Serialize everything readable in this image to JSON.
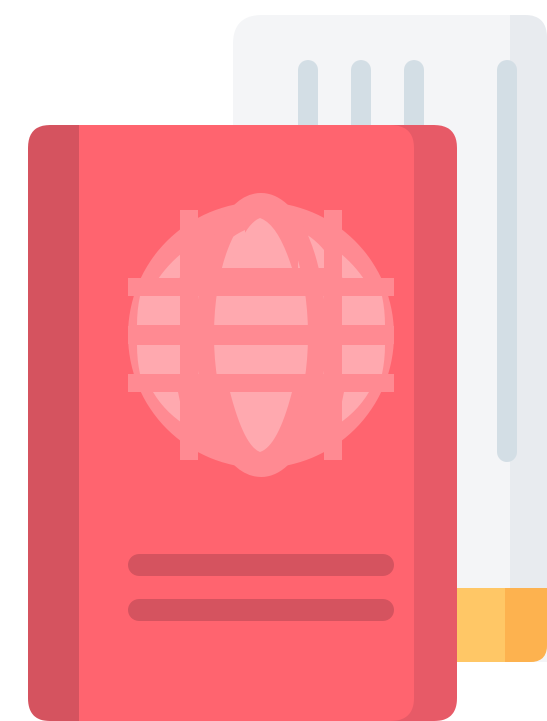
{
  "illustration": {
    "subject": "passport-with-boarding-ticket-icon",
    "colors": {
      "ticket_body": "#F4F5F7",
      "ticket_shade": "#E8EBEF",
      "ticket_bars": "#D3DEE5",
      "ticket_stub": "#FFC766",
      "ticket_stub_shade": "#FDB24F",
      "passport_cover": "#FF646F",
      "passport_spine": "#D5535F",
      "passport_right_edge": "#E75A67",
      "globe": "#FF8A92",
      "globe_panels": "#FFA9AF",
      "text_lines": "#D5535F"
    }
  }
}
